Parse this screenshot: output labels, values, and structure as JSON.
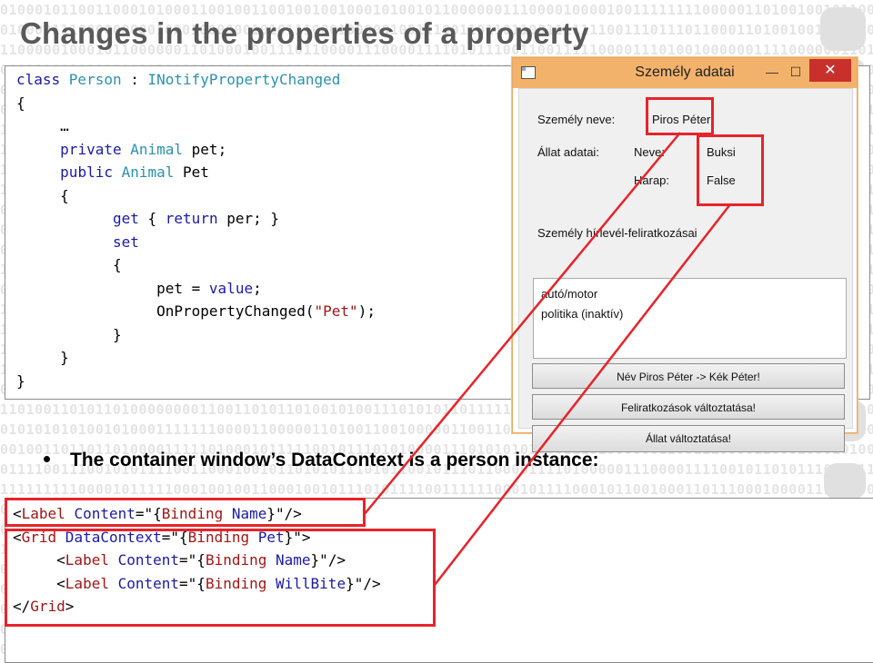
{
  "slide": {
    "title": "Changes in the properties of a property",
    "bullet": "The container window’s DataContext is a person instance:"
  },
  "colors": {
    "highlight": "#e8232a",
    "titlebar": "#f3b26b",
    "keyword": "#1a1aa6",
    "type": "#2b91af",
    "string": "#a31515"
  },
  "code_top": {
    "lines": [
      [
        {
          "t": "class ",
          "c": "kw"
        },
        {
          "t": "Person",
          "c": "ty"
        },
        {
          "t": " : ",
          "c": ""
        },
        {
          "t": "INotifyPropertyChanged",
          "c": "ty"
        }
      ],
      [
        {
          "t": "{",
          "c": ""
        }
      ],
      [
        {
          "t": "     …",
          "c": ""
        }
      ],
      [
        {
          "t": "     ",
          "c": ""
        },
        {
          "t": "private ",
          "c": "kw"
        },
        {
          "t": "Animal",
          "c": "ty"
        },
        {
          "t": " pet;",
          "c": ""
        }
      ],
      [
        {
          "t": "     ",
          "c": ""
        },
        {
          "t": "public ",
          "c": "kw"
        },
        {
          "t": "Animal",
          "c": "ty"
        },
        {
          "t": " Pet",
          "c": ""
        }
      ],
      [
        {
          "t": "     {",
          "c": ""
        }
      ],
      [
        {
          "t": "           ",
          "c": ""
        },
        {
          "t": "get",
          "c": "kw"
        },
        {
          "t": " { ",
          "c": ""
        },
        {
          "t": "return",
          "c": "kw"
        },
        {
          "t": " per; }",
          "c": ""
        }
      ],
      [
        {
          "t": "           ",
          "c": ""
        },
        {
          "t": "set",
          "c": "kw"
        }
      ],
      [
        {
          "t": "           {",
          "c": ""
        }
      ],
      [
        {
          "t": "                pet = ",
          "c": ""
        },
        {
          "t": "value",
          "c": "kw"
        },
        {
          "t": ";",
          "c": ""
        }
      ],
      [
        {
          "t": "                OnPropertyChanged(",
          "c": ""
        },
        {
          "t": "\"Pet\"",
          "c": "str"
        },
        {
          "t": ");",
          "c": ""
        }
      ],
      [
        {
          "t": "           }",
          "c": ""
        }
      ],
      [
        {
          "t": "     }",
          "c": ""
        }
      ],
      [
        {
          "t": "}",
          "c": ""
        }
      ]
    ]
  },
  "code_bottom": {
    "lines": [
      [
        {
          "t": "<",
          "c": ""
        },
        {
          "t": "Label",
          "c": "str"
        },
        {
          "t": " Content",
          "c": "xa"
        },
        {
          "t": "=\"{",
          "c": ""
        },
        {
          "t": "Binding",
          "c": "str"
        },
        {
          "t": " Name",
          "c": "xa"
        },
        {
          "t": "}\"/>",
          "c": ""
        }
      ],
      [
        {
          "t": "<",
          "c": ""
        },
        {
          "t": "Grid",
          "c": "str"
        },
        {
          "t": " DataContext",
          "c": "xa"
        },
        {
          "t": "=\"{",
          "c": ""
        },
        {
          "t": "Binding",
          "c": "str"
        },
        {
          "t": " Pet",
          "c": "xa"
        },
        {
          "t": "}\">",
          "c": ""
        }
      ],
      [
        {
          "t": "     <",
          "c": ""
        },
        {
          "t": "Label",
          "c": "str"
        },
        {
          "t": " Content",
          "c": "xa"
        },
        {
          "t": "=\"{",
          "c": ""
        },
        {
          "t": "Binding",
          "c": "str"
        },
        {
          "t": " Name",
          "c": "xa"
        },
        {
          "t": "}\"/>",
          "c": ""
        }
      ],
      [
        {
          "t": "     <",
          "c": ""
        },
        {
          "t": "Label",
          "c": "str"
        },
        {
          "t": " Content",
          "c": "xa"
        },
        {
          "t": "=\"{",
          "c": ""
        },
        {
          "t": "Binding",
          "c": "str"
        },
        {
          "t": " WillBite",
          "c": "xa"
        },
        {
          "t": "}\"/>",
          "c": ""
        }
      ],
      [
        {
          "t": "</",
          "c": ""
        },
        {
          "t": "Grid",
          "c": "str"
        },
        {
          "t": ">",
          "c": ""
        }
      ]
    ]
  },
  "window": {
    "title": "Személy adatai",
    "min_glyph": "—",
    "max_glyph": "☐",
    "close_glyph": "✕",
    "person_name_label": "Személy neve:",
    "person_name_value": "Piros Péter",
    "animal_label": "Állat adatai:",
    "animal_name_label": "Neve:",
    "animal_name_value": "Buksi",
    "animal_bite_label": "Harap:",
    "animal_bite_value": "False",
    "subscriptions_label": "Személy hírlevél-feliratkozásai",
    "subscriptions": [
      "autó/motor",
      "politika (inaktív)"
    ],
    "btn_rename": "Név Piros Péter -> Kék Péter!",
    "btn_subscriptions": "Feliratkozások változtatása!",
    "btn_animal": "Állat változtatása!"
  }
}
